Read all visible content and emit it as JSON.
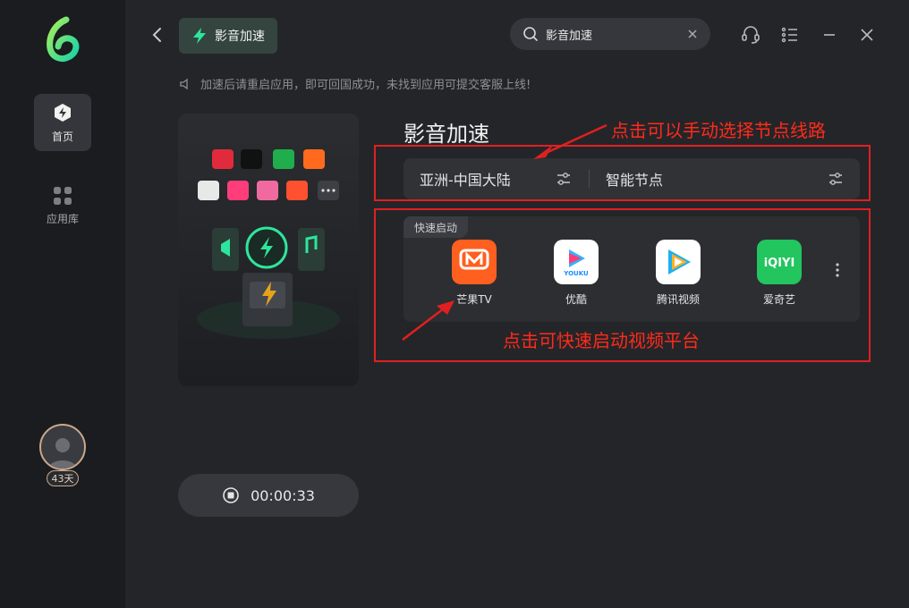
{
  "sidebar": {
    "items": [
      {
        "label": "首页",
        "icon": "home-bolt-icon",
        "active": true
      },
      {
        "label": "应用库",
        "icon": "app-grid-icon",
        "active": false
      }
    ],
    "user": {
      "days_badge": "43天"
    }
  },
  "header": {
    "tab_label": "影音加速",
    "search_value": "影音加速"
  },
  "notice": "加速后请重启应用，即可回国成功，未找到应用可提交客服上线!",
  "main": {
    "title": "影音加速",
    "nodes": [
      {
        "label": "亚洲-中国大陆"
      },
      {
        "label": "智能节点"
      }
    ],
    "quick_launch": {
      "tag": "快速启动",
      "apps": [
        {
          "name": "芒果TV",
          "color": "#ff5f1f"
        },
        {
          "name": "优酷",
          "color": "#ffffff"
        },
        {
          "name": "腾讯视频",
          "color": "#ffffff"
        },
        {
          "name": "爱奇艺",
          "color": "#22c55e"
        }
      ]
    },
    "timer": "00:00:33"
  },
  "annotations": {
    "node_hint": "点击可以手动选择节点线路",
    "quick_hint": "点击可快速启动视频平台",
    "color": "#e02020"
  },
  "colors": {
    "accent": "#2ee59d",
    "background": "#242529",
    "sidebar": "#1b1c1f"
  }
}
